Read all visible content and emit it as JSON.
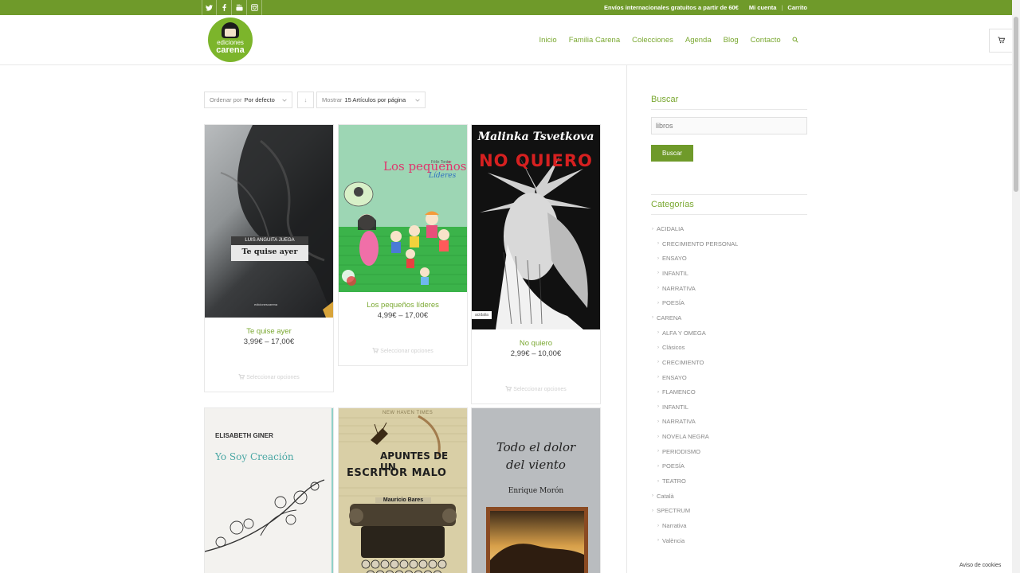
{
  "topbar": {
    "social": [
      "twitter-icon",
      "facebook-icon",
      "youtube-icon",
      "instagram-icon"
    ],
    "promo": "Envíos internacionales gratuitos a partir de 60€",
    "my_account": "Mi cuenta",
    "cart": "Carrito"
  },
  "brand": {
    "logo_line1": "ediciones",
    "logo_line2": "carena",
    "accent": "#7aa831",
    "bar_color": "#6f9a2a"
  },
  "nav": {
    "items": [
      "Inicio",
      "Familia Carena",
      "Colecciones",
      "Agenda",
      "Blog",
      "Contacto"
    ]
  },
  "ordering": {
    "sort_prefix": "Ordenar por",
    "sort_value": "Por defecto",
    "direction_symbol": "↓",
    "show_prefix": "Mostrar",
    "show_value": "15 Artículos por página"
  },
  "products": [
    {
      "title": "Te quise ayer",
      "price": "3,99€ – 17,00€",
      "action": "Seleccionar opciones",
      "cover_author": "LUIS ANGUITA JUEGA",
      "cover_title": "Te quise ayer",
      "cover_publisher": "edicionescarena"
    },
    {
      "title": "Los pequeños líderes",
      "price": "4,99€ – 17,00€",
      "action": "Seleccionar opciones",
      "cover_author": "Félix Toráe",
      "cover_title": "Los pequeños",
      "cover_subtitle": "Líderes"
    },
    {
      "title": "No quiero",
      "price": "2,99€ – 10,00€",
      "action": "Seleccionar opciones",
      "cover_author": "Malinka Tsvetkova",
      "cover_title": "NO QUIERO",
      "cover_publisher": "acidalia"
    },
    {
      "cover_author": "ELISABETH GINER",
      "cover_title": "Yo Soy Creación"
    },
    {
      "cover_newspaper": "NEW HAVEN TIMES",
      "cover_title_1": "APUNTES DE UN",
      "cover_title_2": "ESCRITOR MALO",
      "cover_author": "Mauricio Bares"
    },
    {
      "cover_title_1": "Todo el dolor",
      "cover_title_2": "del viento",
      "cover_author": "Enrique Morón"
    }
  ],
  "sidebar": {
    "search_title": "Buscar",
    "search_value": "libros",
    "search_button": "Buscar",
    "categories_title": "Categorías",
    "categories": [
      {
        "label": "ACIDALIA",
        "level": 0
      },
      {
        "label": "CRECIMIENTO PERSONAL",
        "level": 1
      },
      {
        "label": "ENSAYO",
        "level": 1
      },
      {
        "label": "INFANTIL",
        "level": 1
      },
      {
        "label": "NARRATIVA",
        "level": 1
      },
      {
        "label": "POESÍA",
        "level": 1
      },
      {
        "label": "CARENA",
        "level": 0
      },
      {
        "label": "ALFA Y OMEGA",
        "level": 1
      },
      {
        "label": "Clásicos",
        "level": 1
      },
      {
        "label": "CRECIMIENTO",
        "level": 1
      },
      {
        "label": "ENSAYO",
        "level": 1
      },
      {
        "label": "FLAMENCO",
        "level": 1
      },
      {
        "label": "INFANTIL",
        "level": 1
      },
      {
        "label": "NARRATIVA",
        "level": 1
      },
      {
        "label": "NOVELA NEGRA",
        "level": 1
      },
      {
        "label": "PERIODISMO",
        "level": 1
      },
      {
        "label": "POESÍA",
        "level": 1
      },
      {
        "label": "TEATRO",
        "level": 1
      },
      {
        "label": "Català",
        "level": 0
      },
      {
        "label": "SPECTRUM",
        "level": 0
      },
      {
        "label": "Narrativa",
        "level": 1
      },
      {
        "label": "València",
        "level": 1
      }
    ]
  },
  "cookie_notice": "Aviso de cookies"
}
